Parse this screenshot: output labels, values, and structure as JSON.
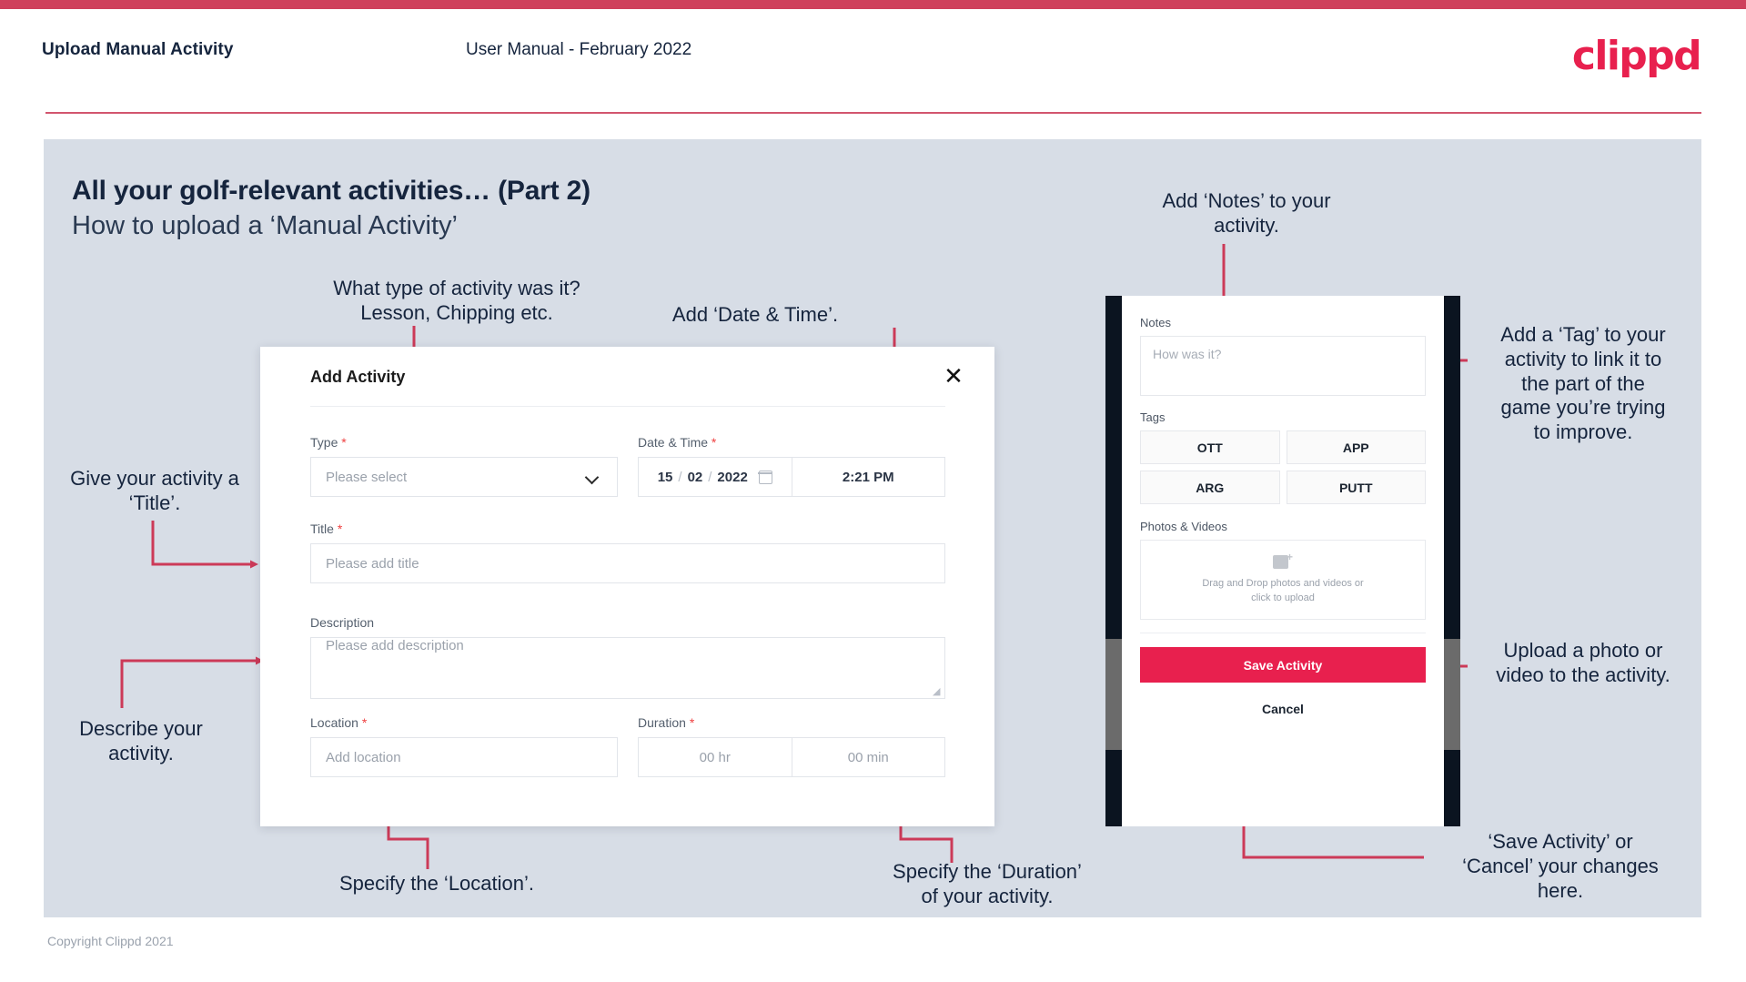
{
  "header": {
    "title": "Upload Manual Activity",
    "subtitle": "User Manual - February 2022",
    "logo": "clippd"
  },
  "slide": {
    "title": "All your golf-relevant activities… (Part 2)",
    "subtitle": "How to upload a ‘Manual Activity’",
    "footer": "Copyright Clippd 2021"
  },
  "modal": {
    "title": "Add Activity",
    "close_icon": "✕",
    "fields": {
      "type": {
        "label": "Type",
        "required": "*",
        "value": "Please select"
      },
      "datetime": {
        "label": "Date & Time",
        "required": "*",
        "day": "15",
        "month": "02",
        "year": "2022",
        "sep": "/",
        "time": "2:21 PM"
      },
      "title": {
        "label": "Title",
        "required": "*",
        "placeholder": "Please add title"
      },
      "description": {
        "label": "Description",
        "required": "",
        "placeholder": "Please add description"
      },
      "location": {
        "label": "Location",
        "required": "*",
        "placeholder": "Add location"
      },
      "duration": {
        "label": "Duration",
        "required": "*",
        "hours": "00 hr",
        "minutes": "00 min"
      }
    }
  },
  "phone": {
    "notes": {
      "label": "Notes",
      "placeholder": "How was it?"
    },
    "tags": {
      "label": "Tags",
      "items": [
        "OTT",
        "APP",
        "ARG",
        "PUTT"
      ]
    },
    "media": {
      "label": "Photos & Videos",
      "drop_line1": "Drag and Drop photos and videos or",
      "drop_line2": "click to upload"
    },
    "save_label": "Save Activity",
    "cancel_label": "Cancel"
  },
  "annotations": {
    "type": "What type of activity was it?\nLesson, Chipping etc.",
    "datetime": "Add ‘Date & Time’.",
    "title": "Give your activity a\n‘Title’.",
    "description": "Describe your\nactivity.",
    "location": "Specify the ‘Location’.",
    "duration": "Specify the ‘Duration’\nof your activity.",
    "notes": "Add ‘Notes’ to your\nactivity.",
    "tags": "Add a ‘Tag’ to your\nactivity to link it to\nthe part of the\ngame you’re trying\nto improve.",
    "media": "Upload a photo or\nvideo to the activity.",
    "save": "‘Save Activity’ or\n‘Cancel’ your changes\nhere."
  },
  "colors": {
    "brand": "#e8204e",
    "accent_bar": "#cf405c",
    "connector": "#cc3a58",
    "slide_bg": "#d7dde6",
    "text_dark": "#15243d"
  }
}
